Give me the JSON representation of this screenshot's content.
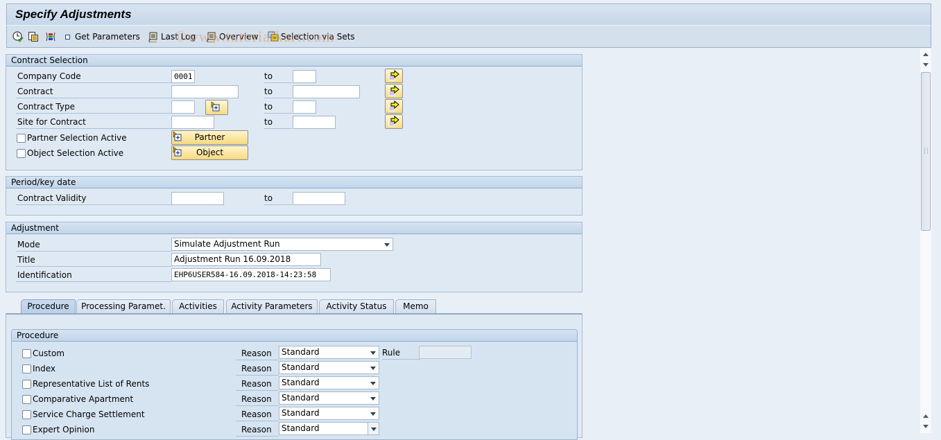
{
  "window": {
    "title": "Specify Adjustments"
  },
  "toolbar": {
    "icons": [
      "execute-icon",
      "copy-icon",
      "layout-icon"
    ],
    "buttons": [
      {
        "label": "Get Parameters",
        "icon": "square-icon"
      },
      {
        "label": "Last Log",
        "icon": "scroll-log-icon"
      },
      {
        "label": "Overview",
        "icon": "scroll-overview-icon"
      },
      {
        "label": "Selection via Sets",
        "icon": "selection-sets-icon"
      }
    ]
  },
  "watermark": "©www.tutorialkart.com",
  "contract_selection": {
    "title": "Contract Selection",
    "to_label": "to",
    "rows": [
      {
        "label": "Company Code",
        "from": "0001",
        "to": ""
      },
      {
        "label": "Contract",
        "from": "",
        "to": ""
      },
      {
        "label": "Contract Type",
        "from": "",
        "to": ""
      },
      {
        "label": "Site for Contract",
        "from": "",
        "to": ""
      }
    ],
    "partner_checkbox": {
      "label": "Partner Selection Active",
      "checked": false
    },
    "object_checkbox": {
      "label": "Object Selection Active",
      "checked": false
    },
    "partner_button": "Partner",
    "object_button": "Object"
  },
  "period": {
    "title": "Period/key date",
    "label": "Contract Validity",
    "from": "",
    "to_label": "to",
    "to": ""
  },
  "adjustment": {
    "title": "Adjustment",
    "mode_label": "Mode",
    "mode_value": "Simulate Adjustment Run",
    "title_label": "Title",
    "title_value": "Adjustment Run 16.09.2018",
    "identification_label": "Identification",
    "identification_value": "EHP6USER584-16.09.2018-14:23:58"
  },
  "tabs": [
    {
      "label": "Procedure",
      "active": true
    },
    {
      "label": "Processing Paramet.",
      "active": false
    },
    {
      "label": "Activities",
      "active": false
    },
    {
      "label": "Activity Parameters",
      "active": false
    },
    {
      "label": "Activity Status",
      "active": false
    },
    {
      "label": "Memo",
      "active": false
    }
  ],
  "procedure": {
    "title": "Procedure",
    "reason_label": "Reason",
    "rule_label": "Rule",
    "rule_value": "",
    "items": [
      {
        "label": "Custom",
        "checked": false,
        "reason": "Standard"
      },
      {
        "label": "Index",
        "checked": false,
        "reason": "Standard"
      },
      {
        "label": "Representative List of Rents",
        "checked": false,
        "reason": "Standard"
      },
      {
        "label": "Comparative Apartment",
        "checked": false,
        "reason": "Standard"
      },
      {
        "label": "Service Charge Settlement",
        "checked": false,
        "reason": "Standard"
      },
      {
        "label": "Expert Opinion",
        "checked": false,
        "reason": "Standard"
      }
    ]
  }
}
